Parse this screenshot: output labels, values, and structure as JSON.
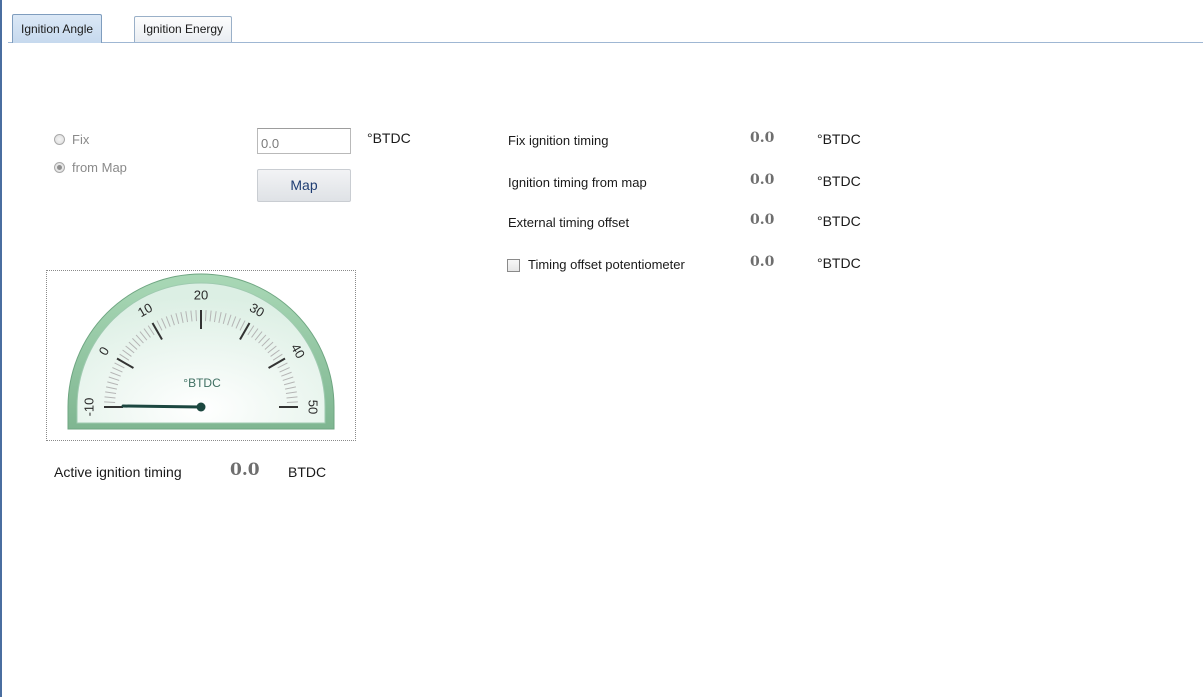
{
  "tabs": [
    {
      "label": "Ignition Angle",
      "active": true
    },
    {
      "label": "Ignition Energy",
      "active": false
    }
  ],
  "mode": {
    "fix_label": "Fix",
    "map_label": "from Map",
    "selected": "from Map",
    "input_value": "0.0",
    "input_unit": "°BTDC",
    "map_button": "Map"
  },
  "readouts": {
    "fix": {
      "label": "Fix ignition timing",
      "value": "0.0",
      "unit": "°BTDC"
    },
    "from_map": {
      "label": "Ignition timing from map",
      "value": "0.0",
      "unit": "°BTDC"
    },
    "external": {
      "label": "External timing offset",
      "value": "0.0",
      "unit": "°BTDC"
    },
    "pot": {
      "label": "Timing offset potentiometer",
      "value": "0.0",
      "unit": "°BTDC",
      "checked": false
    }
  },
  "gauge": {
    "unit_label": "°BTDC",
    "min": -10,
    "max": 50,
    "value": 0.0,
    "major_labels": [
      "-10",
      "0",
      "10",
      "20",
      "30",
      "40",
      "50"
    ]
  },
  "active": {
    "label": "Active ignition timing",
    "value": "0.0",
    "unit": "BTDC"
  },
  "colors": {
    "tab_active": "#c6d9ee",
    "gauge_rim": "#8ec49f",
    "gauge_face": "#e4f3ec",
    "needle": "#1c4740",
    "value_gray": "#6e6e6e"
  }
}
